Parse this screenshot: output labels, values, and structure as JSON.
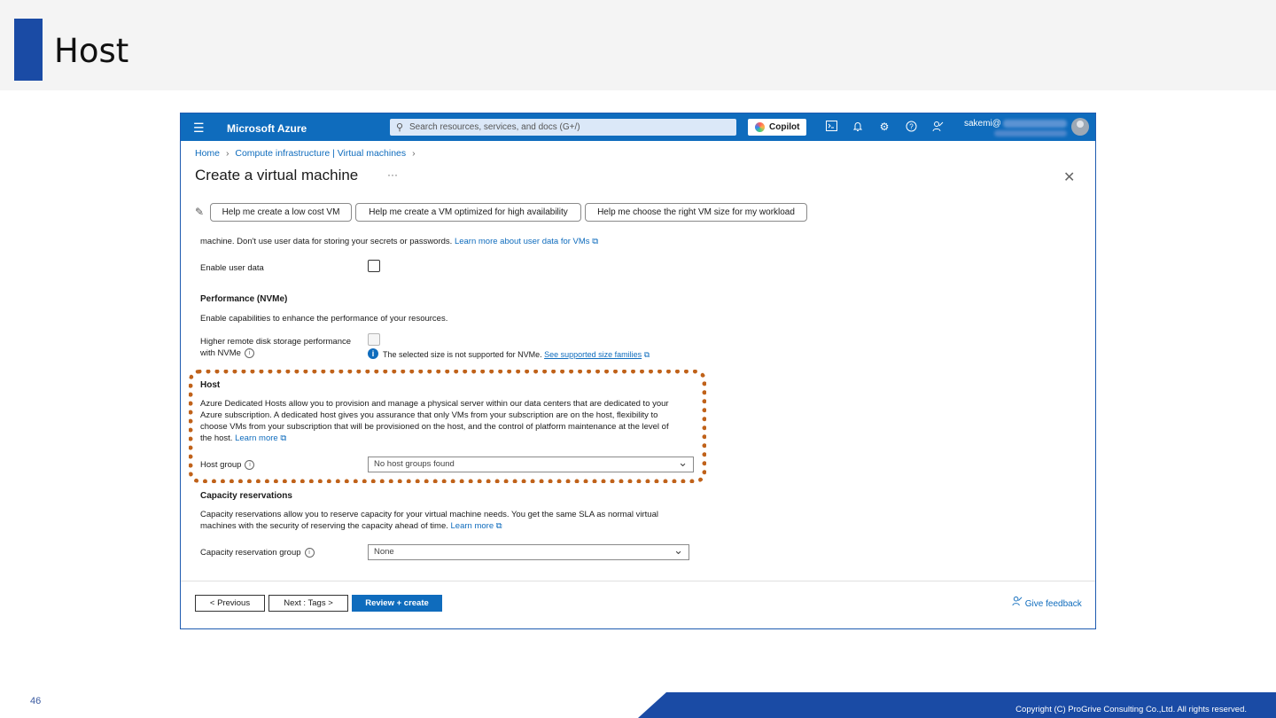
{
  "slide": {
    "title": "Host",
    "page_number": "46",
    "copyright": "Copyright (C) ProGrive Consulting Co.,Ltd. All rights reserved.",
    "accent_color": "#1a4ba5",
    "highlight_color": "#c0621a"
  },
  "topbar": {
    "brand": "Microsoft Azure",
    "search_placeholder": "Search resources, services, and docs (G+/)",
    "copilot_label": "Copilot",
    "user": "sakemi@",
    "icons": [
      "menu-icon",
      "cloud-shell-icon",
      "bell-icon",
      "gear-icon",
      "help-icon",
      "feedback-icon",
      "avatar"
    ],
    "bar_color": "#0f6cbd"
  },
  "breadcrumb": {
    "home": "Home",
    "parent": "Compute infrastructure | Virtual machines"
  },
  "page": {
    "heading": "Create a virtual machine",
    "more": "···",
    "close": "✕"
  },
  "assist": {
    "buttons": [
      "Help me create a low cost VM",
      "Help me create a VM optimized for high availability",
      "Help me choose the right VM size for my workload"
    ]
  },
  "user_data": {
    "partial_text": "machine. Don't use user data for storing your secrets or passwords.",
    "link": "Learn more about user data for VMs",
    "enable_label": "Enable user data",
    "enabled": false
  },
  "performance": {
    "heading": "Performance (NVMe)",
    "description": "Enable capabilities to enhance the performance of your resources.",
    "nvme_label_line1": "Higher remote disk storage performance",
    "nvme_label_line2": "with NVMe",
    "nvme_enabled": false,
    "notice": "The selected size is not supported for NVMe.",
    "notice_link": "See supported size families"
  },
  "host": {
    "heading": "Host",
    "desc_line1": "Azure Dedicated Hosts allow you to provision and manage a physical server within our data centers that are dedicated to your",
    "desc_line2": "Azure subscription. A dedicated host gives you assurance that only VMs from your subscription are on the host, flexibility to",
    "desc_line3": "choose VMs from your subscription that will be provisioned on the host, and the control of platform maintenance at the level of",
    "desc_line4": "the host.",
    "learn_more": "Learn more",
    "group_label": "Host group",
    "group_value": "No host groups found"
  },
  "capacity": {
    "heading": "Capacity reservations",
    "desc_line1": "Capacity reservations allow you to reserve capacity for your virtual machine needs. You get the same SLA as normal virtual",
    "desc_line2": "machines with the security of reserving the capacity ahead of time.",
    "learn_more": "Learn more",
    "group_label": "Capacity reservation group",
    "group_value": "None"
  },
  "footer": {
    "previous": "< Previous",
    "next": "Next : Tags >",
    "review": "Review + create",
    "feedback": "Give feedback"
  }
}
